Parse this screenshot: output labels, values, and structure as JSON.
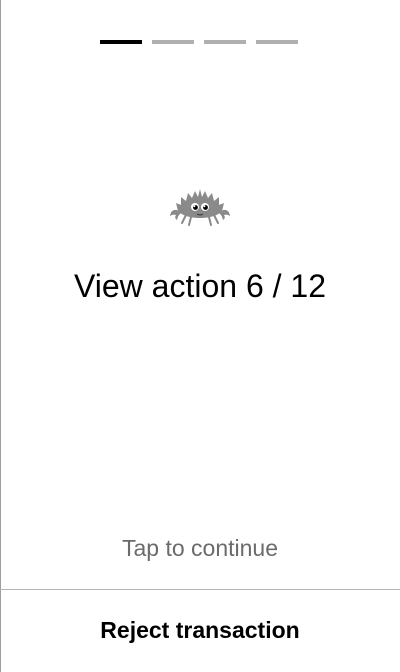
{
  "progress": {
    "segments": 4,
    "active_index": 0,
    "active_color": "#000000",
    "inactive_color": "#b0b0b0"
  },
  "icon": {
    "name": "ferris-crab-icon",
    "color": "#8a8a8a"
  },
  "main": {
    "title": "View action 6 / 12",
    "hint": "Tap to continue"
  },
  "footer": {
    "reject_label": "Reject transaction"
  }
}
